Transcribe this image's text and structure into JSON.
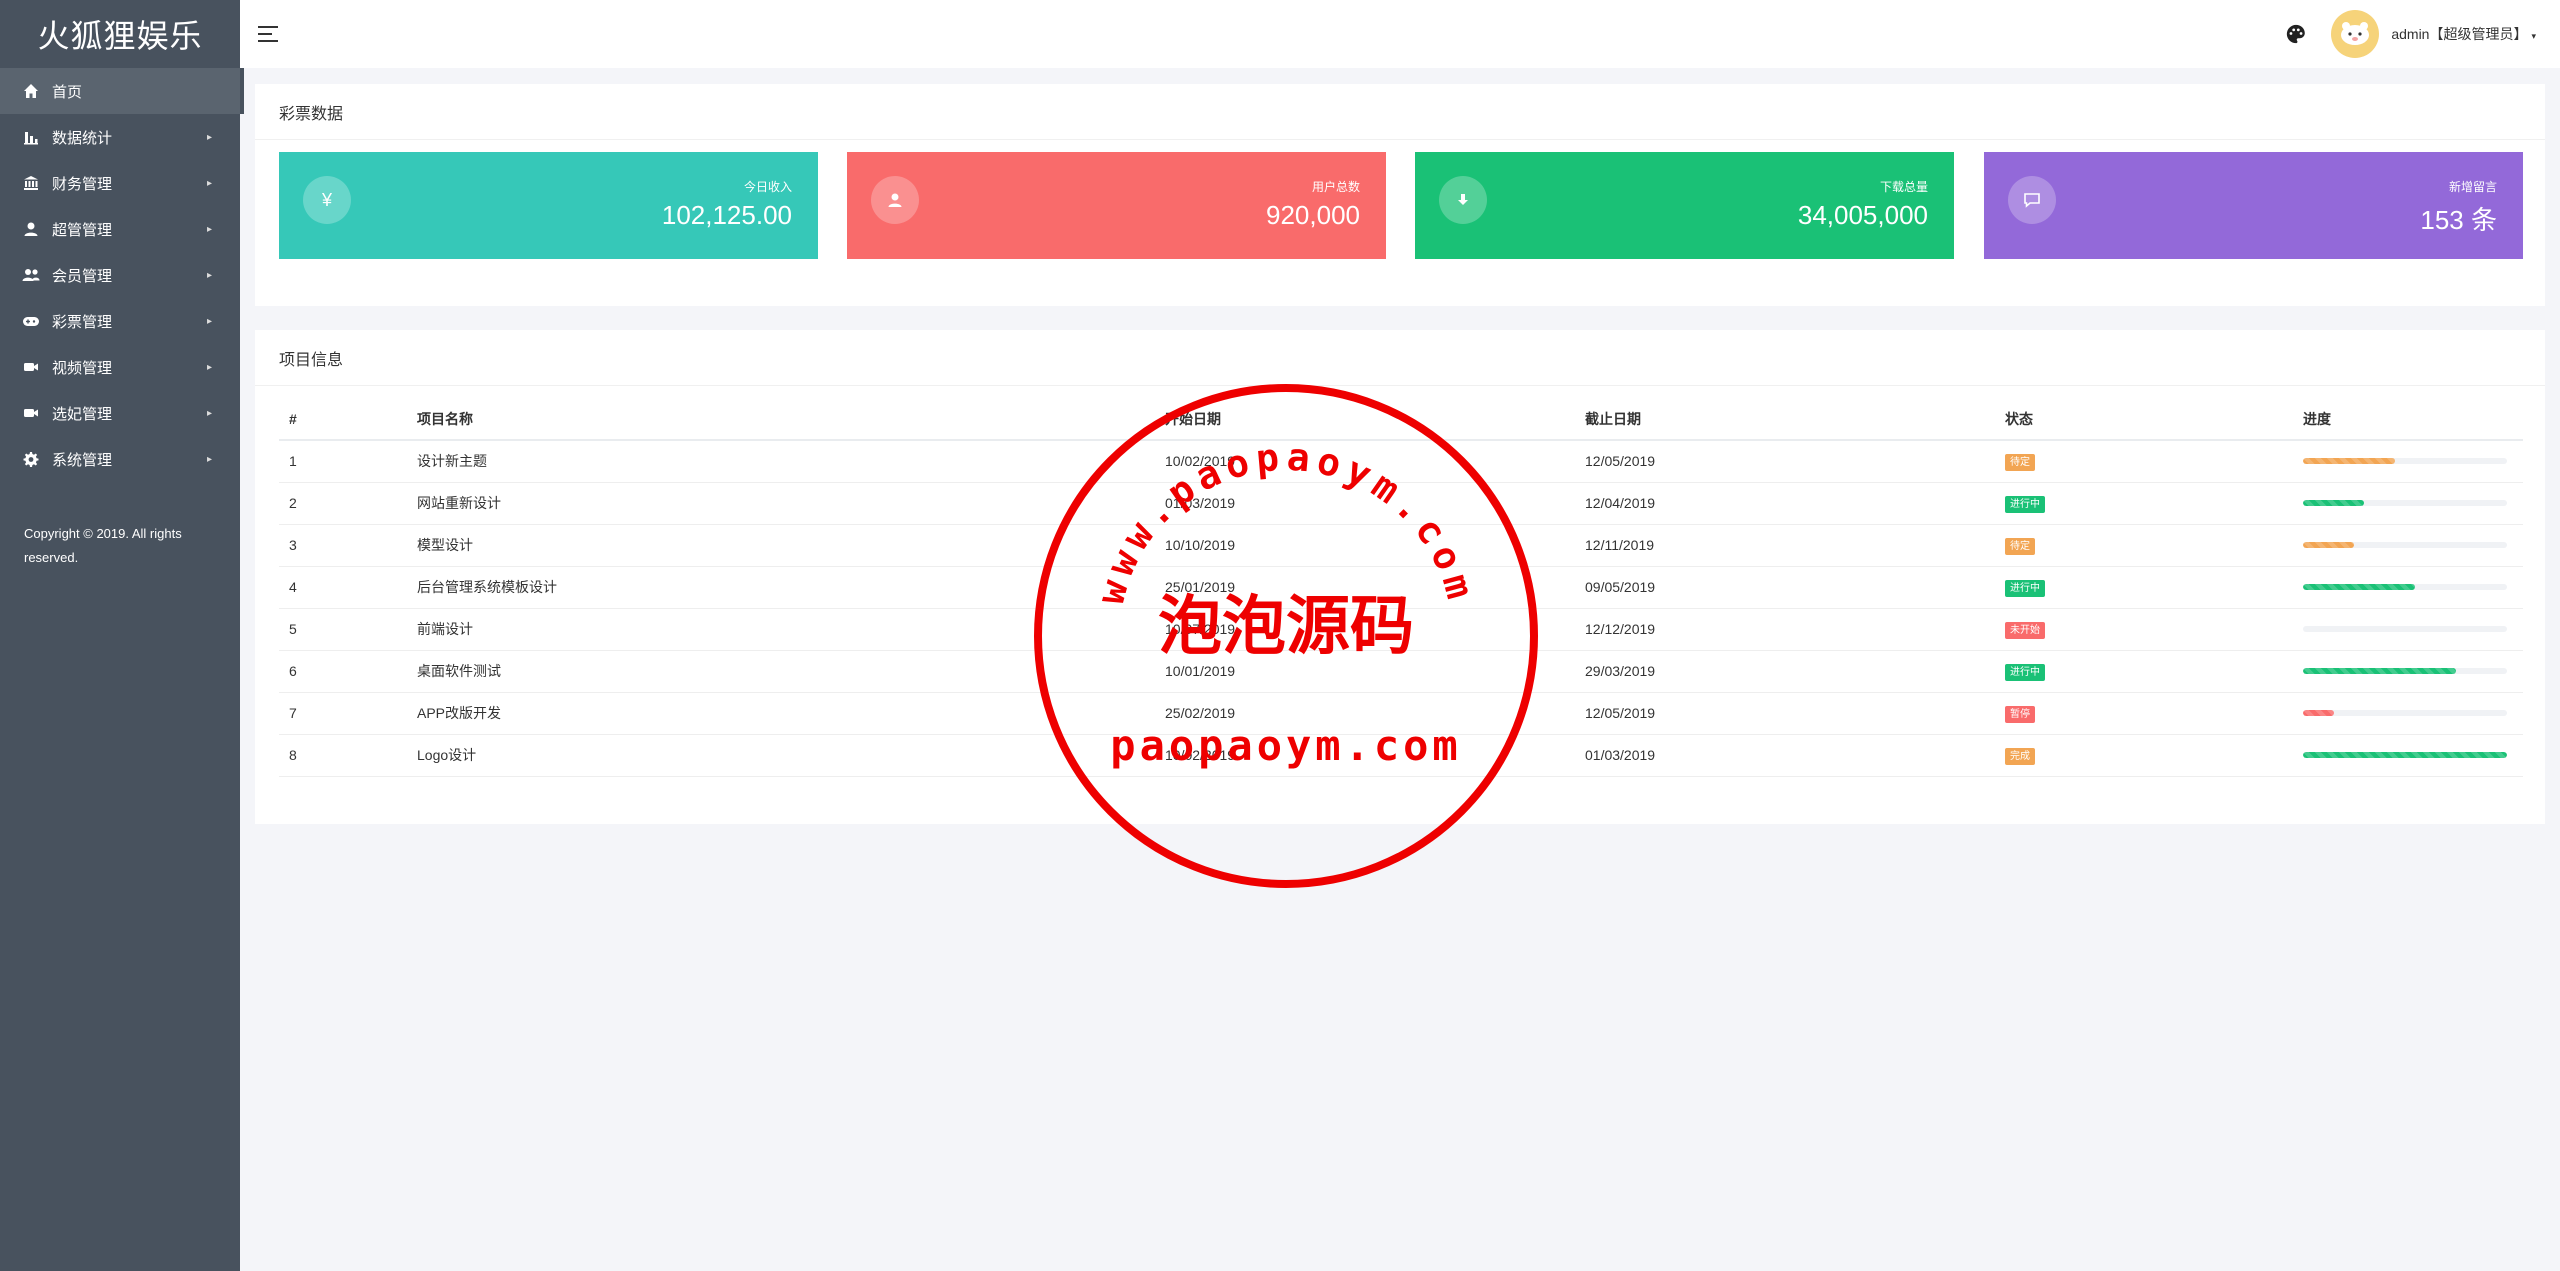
{
  "brand": "火狐狸娱乐",
  "sidebar": {
    "items": [
      {
        "label": "首页",
        "icon": "home-icon",
        "has_caret": false,
        "active": true
      },
      {
        "label": "数据统计",
        "icon": "bar-chart-icon",
        "has_caret": true
      },
      {
        "label": "财务管理",
        "icon": "bank-icon",
        "has_caret": true
      },
      {
        "label": "超管管理",
        "icon": "user-icon",
        "has_caret": true
      },
      {
        "label": "会员管理",
        "icon": "users-icon",
        "has_caret": true
      },
      {
        "label": "彩票管理",
        "icon": "gamepad-icon",
        "has_caret": true
      },
      {
        "label": "视频管理",
        "icon": "video-icon",
        "has_caret": true
      },
      {
        "label": "选妃管理",
        "icon": "video-icon",
        "has_caret": true
      },
      {
        "label": "系统管理",
        "icon": "gear-icon",
        "has_caret": true
      }
    ],
    "copyright": "Copyright © 2019. All rights reserved."
  },
  "header": {
    "user": "admin【超级管理员】",
    "caret": "▾"
  },
  "lottery_panel": {
    "title": "彩票数据",
    "cards": [
      {
        "label": "今日收入",
        "value": "102,125.00",
        "icon": "yen-icon",
        "icon_text": "¥",
        "color": "#36c8b8"
      },
      {
        "label": "用户总数",
        "value": "920,000",
        "icon": "user-icon",
        "color": "#f96b6b"
      },
      {
        "label": "下载总量",
        "value": "34,005,000",
        "icon": "download-icon",
        "color": "#1ac176"
      },
      {
        "label": "新增留言",
        "value": "153 条",
        "icon": "comment-icon",
        "color": "#9369d9"
      }
    ]
  },
  "project_panel": {
    "title": "项目信息",
    "columns": [
      "#",
      "项目名称",
      "开始日期",
      "截止日期",
      "状态",
      "进度"
    ],
    "rows": [
      {
        "id": "1",
        "name": "设计新主题",
        "start": "10/02/2019",
        "end": "12/05/2019",
        "status": "待定",
        "status_color": "#f2a553",
        "progress": 0.45,
        "bar_color": "#f2a553"
      },
      {
        "id": "2",
        "name": "网站重新设计",
        "start": "01/03/2019",
        "end": "12/04/2019",
        "status": "进行中",
        "status_color": "#1ac176",
        "progress": 0.3,
        "bar_color": "#1ac176"
      },
      {
        "id": "3",
        "name": "模型设计",
        "start": "10/10/2019",
        "end": "12/11/2019",
        "status": "待定",
        "status_color": "#f2a553",
        "progress": 0.25,
        "bar_color": "#f2a553"
      },
      {
        "id": "4",
        "name": "后台管理系统模板设计",
        "start": "25/01/2019",
        "end": "09/05/2019",
        "status": "进行中",
        "status_color": "#1ac176",
        "progress": 0.55,
        "bar_color": "#1ac176"
      },
      {
        "id": "5",
        "name": "前端设计",
        "start": "10/07/2019",
        "end": "12/12/2019",
        "status": "未开始",
        "status_color": "#f96b6b",
        "progress": 0.0,
        "bar_color": "#f96b6b"
      },
      {
        "id": "6",
        "name": "桌面软件测试",
        "start": "10/01/2019",
        "end": "29/03/2019",
        "status": "进行中",
        "status_color": "#1ac176",
        "progress": 0.75,
        "bar_color": "#1ac176"
      },
      {
        "id": "7",
        "name": "APP改版开发",
        "start": "25/02/2019",
        "end": "12/05/2019",
        "status": "暂停",
        "status_color": "#f96b6b",
        "progress": 0.15,
        "bar_color": "#f96b6b"
      },
      {
        "id": "8",
        "name": "Logo设计",
        "start": "10/02/2019",
        "end": "01/03/2019",
        "status": "完成",
        "status_color": "#f2a553",
        "progress": 1.0,
        "bar_color": "#1ac176"
      }
    ]
  },
  "stamp": {
    "arc_text": "www.paopaoym.com",
    "center_text": "泡泡源码",
    "bottom_text": "paopaoym.com",
    "color": "#ee0000"
  }
}
